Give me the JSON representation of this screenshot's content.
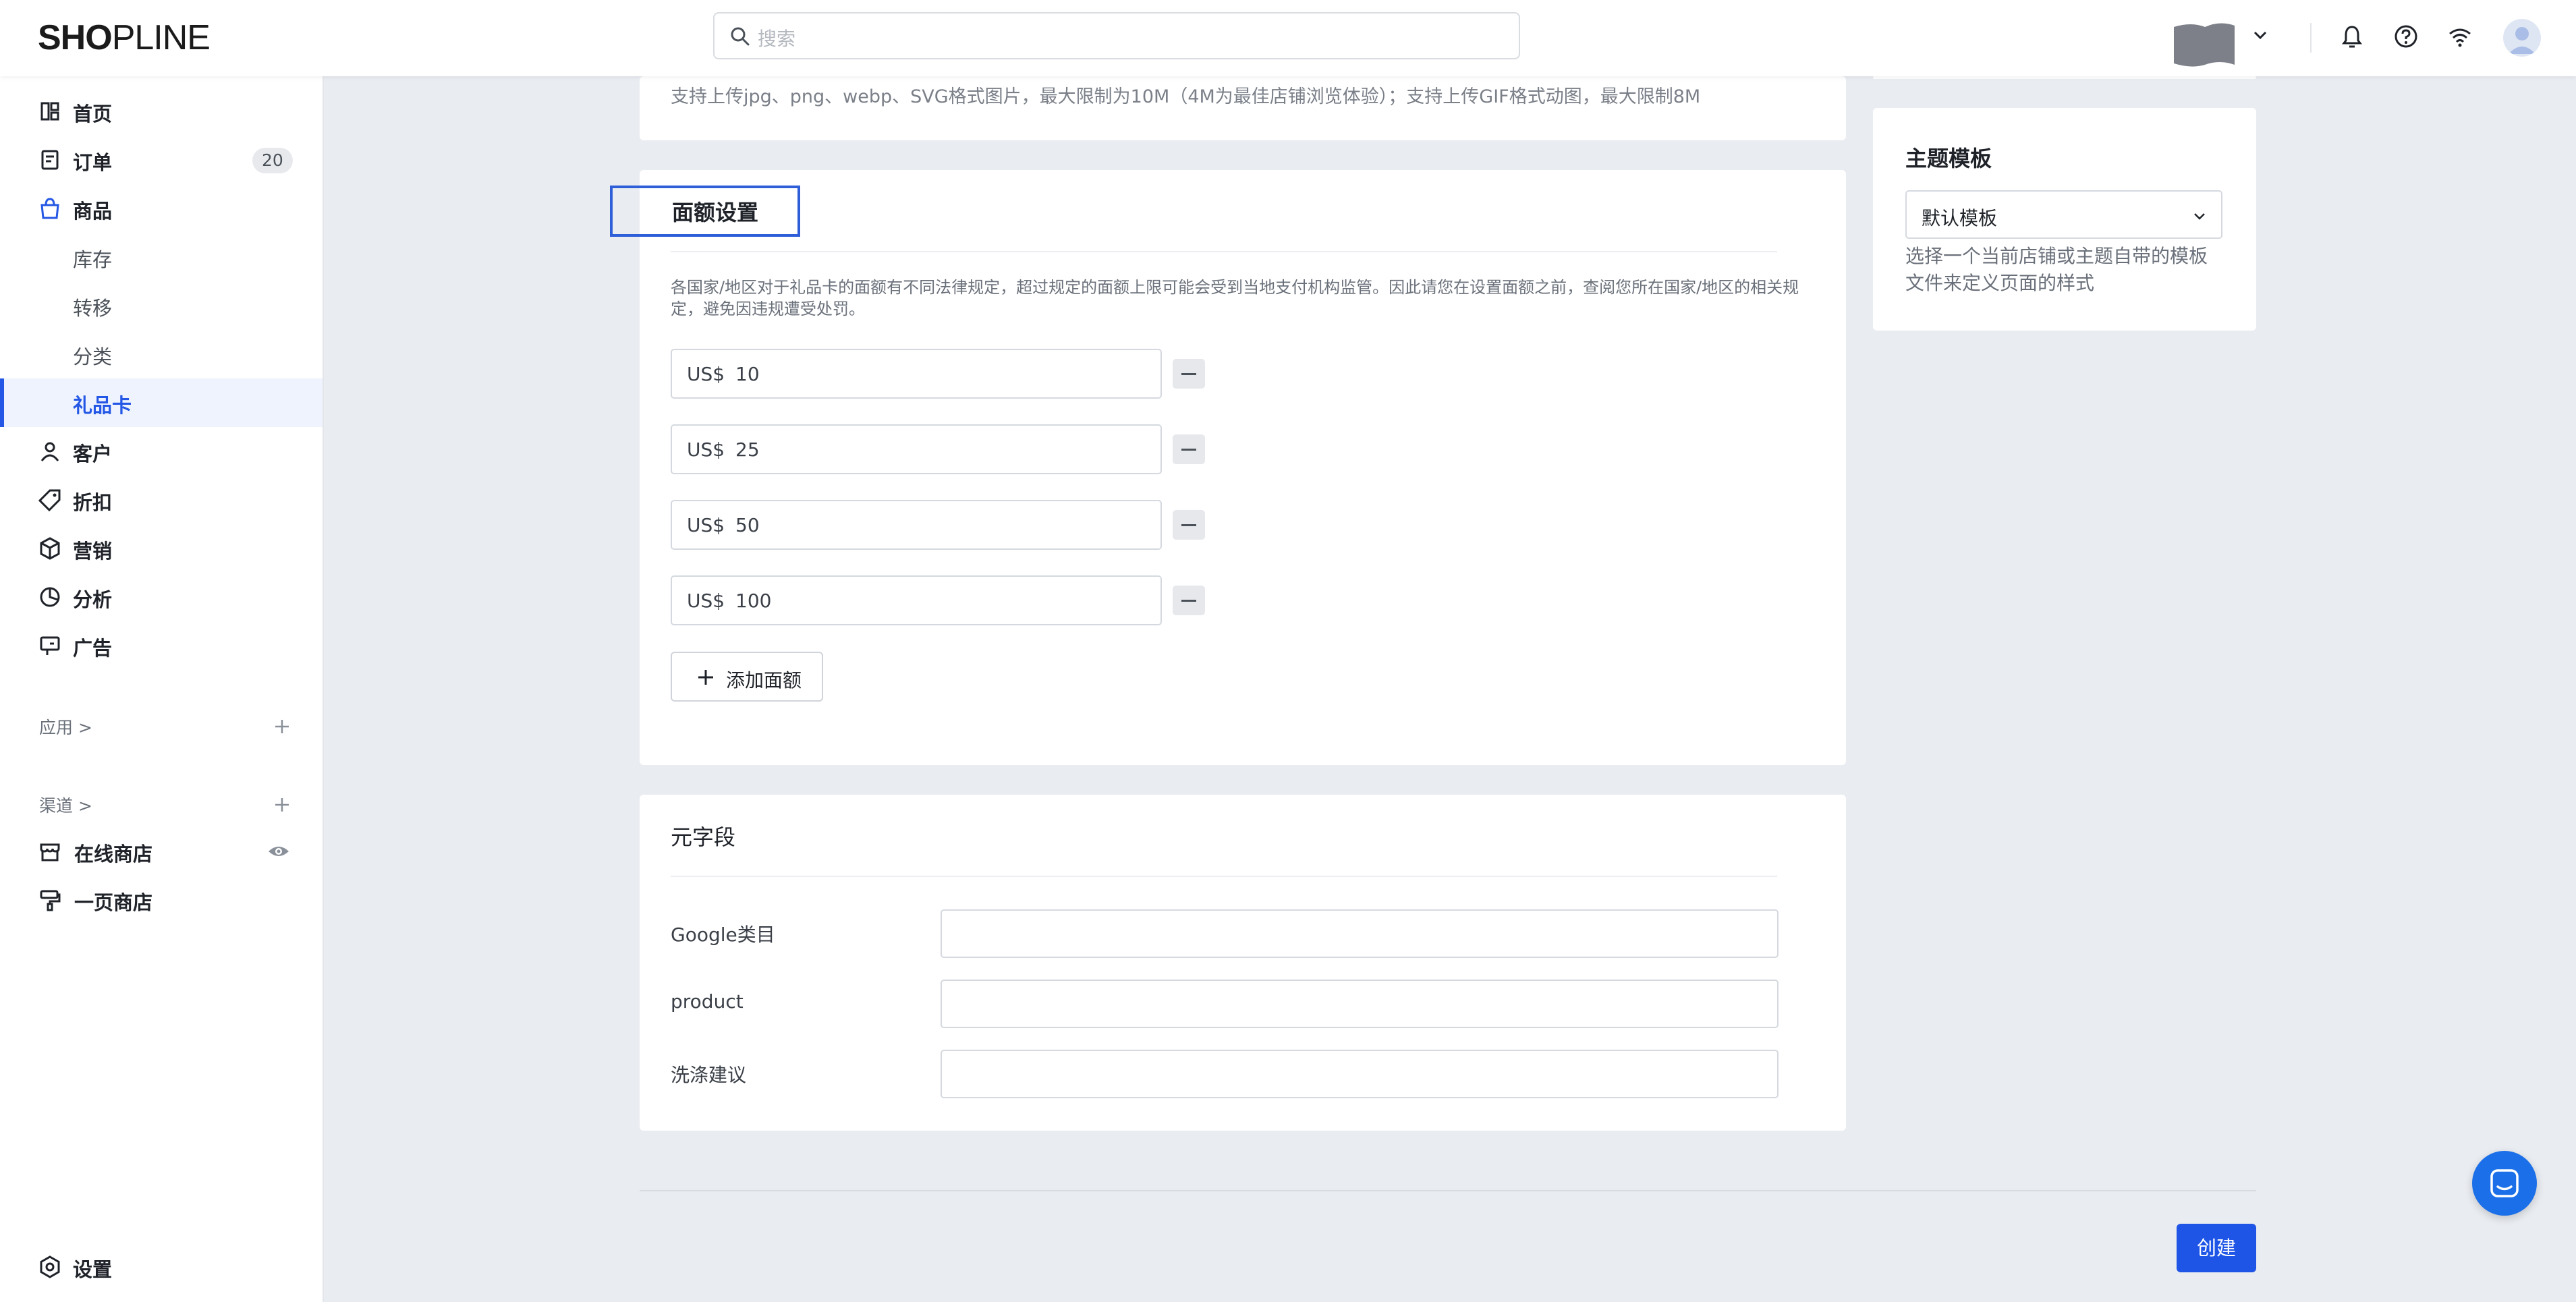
{
  "header": {
    "logo": {
      "left": "SH",
      "mid": "O",
      "right": "PLINE"
    },
    "search_placeholder": "搜索"
  },
  "sidebar": {
    "items": [
      {
        "label": "首页",
        "icon": "dashboard-icon"
      },
      {
        "label": "订单",
        "icon": "order-icon",
        "badge": "20"
      },
      {
        "label": "商品",
        "icon": "bag-icon"
      },
      {
        "label": "库存"
      },
      {
        "label": "转移"
      },
      {
        "label": "分类"
      },
      {
        "label": "礼品卡",
        "active": true
      },
      {
        "label": "客户",
        "icon": "person-icon"
      },
      {
        "label": "折扣",
        "icon": "tag-icon"
      },
      {
        "label": "营销",
        "icon": "cube-icon"
      },
      {
        "label": "分析",
        "icon": "pie-icon"
      },
      {
        "label": "广告",
        "icon": "billboard-icon"
      }
    ],
    "apps_heading": "应用 >",
    "channels_heading": "渠道 >",
    "channels": [
      {
        "label": "在线商店",
        "icon": "store-icon"
      },
      {
        "label": "一页商店",
        "icon": "brush-icon"
      }
    ],
    "settings": "设置"
  },
  "main": {
    "upload_note": "支持上传jpg、png、webp、SVG格式图片，最大限制为10M（4M为最佳店铺浏览体验）；支持上传GIF格式动图，最大限制8M",
    "denomination": {
      "title": "面额设置",
      "description": "各国家/地区对于礼品卡的面额有不同法律规定，超过规定的面额上限可能会受到当地支付机构监管。因此请您在设置面额之前，查阅您所在国家/地区的相关规定，避免因违规遭受处罚。",
      "currency": "US$",
      "amounts": [
        "10",
        "25",
        "50",
        "100"
      ],
      "add_label": "添加面额"
    },
    "metafields": {
      "title": "元字段",
      "fields": [
        {
          "label": "Google类目",
          "value": ""
        },
        {
          "label": "product",
          "value": ""
        },
        {
          "label": "洗涤建议",
          "value": ""
        }
      ]
    },
    "create_label": "创建"
  },
  "theme": {
    "title": "主题模板",
    "selected": "默认模板",
    "description": "选择一个当前店铺或主题自带的模板文件来定义页面的样式"
  },
  "colors": {
    "accent": "#1f55e6",
    "sidebar_active_bg": "#eef3fe",
    "page_bg": "#e9ecf1"
  }
}
